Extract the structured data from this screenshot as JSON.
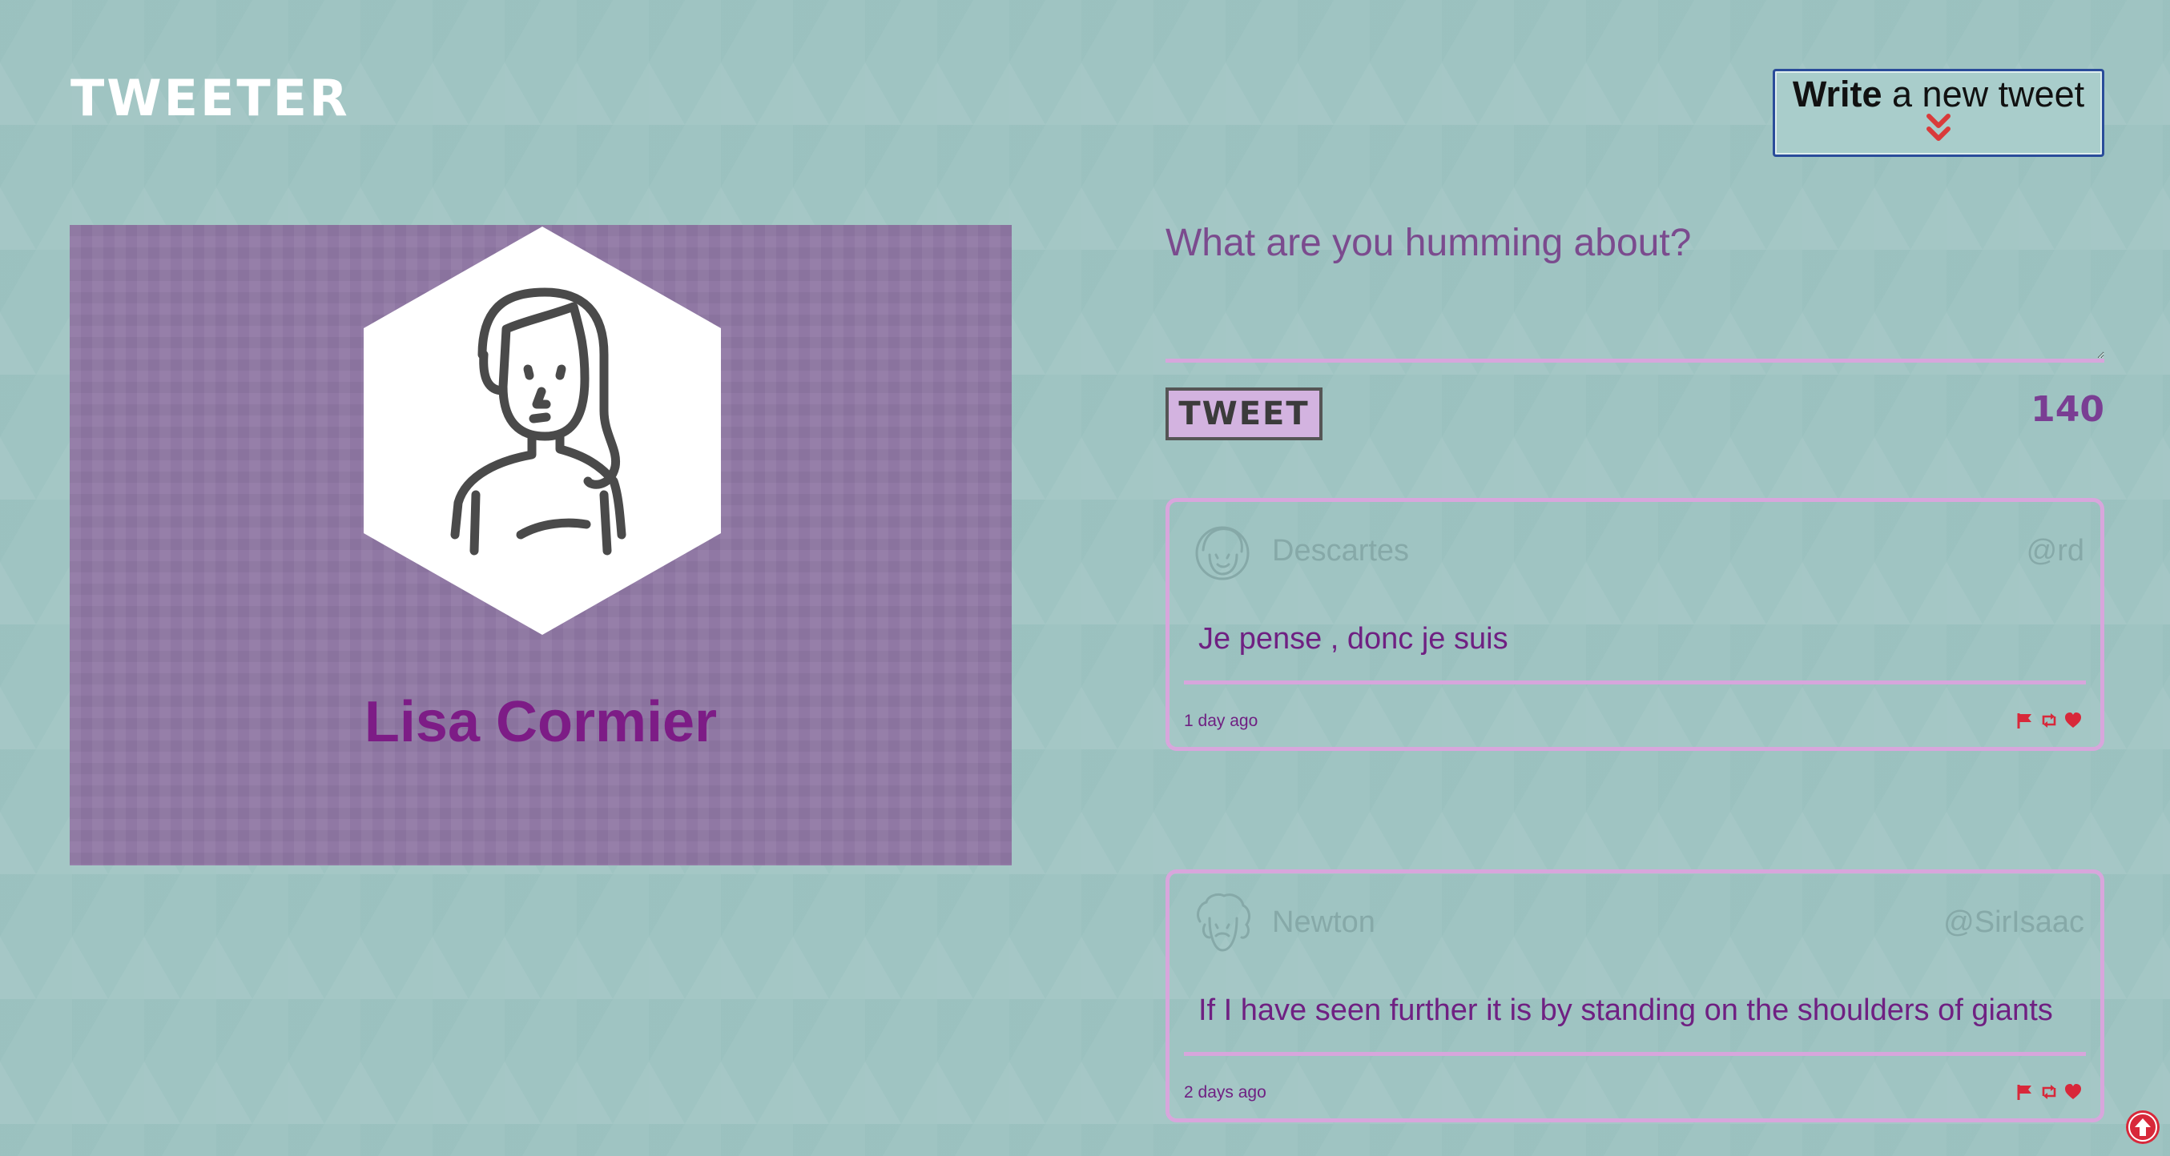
{
  "nav": {
    "brand": "TWEETER",
    "compose_toggle": {
      "bold": "Write",
      "rest": " a new tweet",
      "icon": "double-chevron-down-icon",
      "icon_color": "#d93a3a"
    }
  },
  "profile": {
    "name": "Lisa Cormier",
    "avatar_icon": "user-avatar-icon"
  },
  "composer": {
    "placeholder": "What are you humming about?",
    "value": "",
    "tweet_button_label": "TWEET",
    "counter": "140"
  },
  "tweets": [
    {
      "author": "Descartes",
      "handle": "@rd",
      "content": "Je pense , donc je suis",
      "timestamp": "1 day ago",
      "actions": [
        "flag-icon",
        "retweet-icon",
        "heart-icon"
      ]
    },
    {
      "author": "Newton",
      "handle": "@SirIsaac",
      "content": "If I have seen further it is by standing on the shoulders of giants",
      "timestamp": "2 days ago",
      "actions": [
        "flag-icon",
        "retweet-icon",
        "heart-icon"
      ]
    }
  ],
  "colors": {
    "background": "#9fc4c2",
    "profile_bg": "#9078a4",
    "accent_purple": "#7d1c86",
    "border_pink": "#d8a6dc",
    "action_red": "#d8283a"
  }
}
